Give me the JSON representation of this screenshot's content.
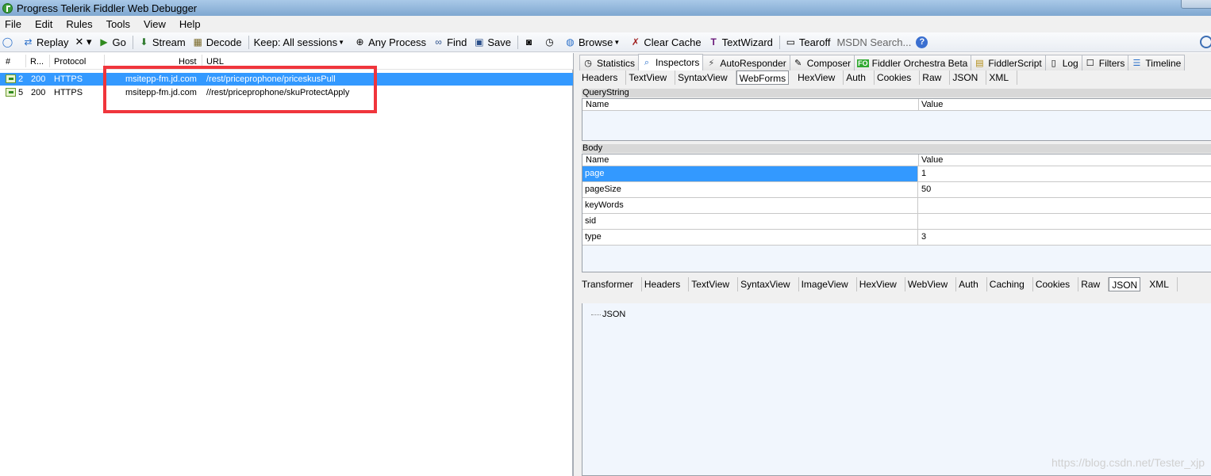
{
  "window": {
    "title": "Progress Telerik Fiddler Web Debugger"
  },
  "menu": [
    "File",
    "Edit",
    "Rules",
    "Tools",
    "View",
    "Help"
  ],
  "toolbar": {
    "replay": "Replay",
    "remove": "✕ ▾",
    "go": "Go",
    "stream": "Stream",
    "decode": "Decode",
    "keep": "Keep: All sessions",
    "process": "Any Process",
    "find": "Find",
    "save": "Save",
    "browse": "Browse",
    "clear_cache": "Clear Cache",
    "textwizard": "TextWizard",
    "tearoff": "Tearoff",
    "search_placeholder": "MSDN Search..."
  },
  "sessions": {
    "columns": {
      "num": "#",
      "result": "R...",
      "protocol": "Protocol",
      "host": "Host",
      "url": "URL"
    },
    "rows": [
      {
        "num": "2",
        "result": "200",
        "protocol": "HTTPS",
        "host": "msitepp-fm.jd.com",
        "url": "/rest/priceprophone/priceskusPull"
      },
      {
        "num": "5",
        "result": "200",
        "protocol": "HTTPS",
        "host": "msitepp-fm.jd.com",
        "url": "//rest/priceprophone/skuProtectApply"
      }
    ]
  },
  "top_tabs": {
    "statistics": "Statistics",
    "inspectors": "Inspectors",
    "autoresponder": "AutoResponder",
    "composer": "Composer",
    "orchestra_badge": "FO",
    "orchestra": "Fiddler Orchestra Beta",
    "fiddlerscript": "FiddlerScript",
    "log": "Log",
    "filters": "Filters",
    "timeline": "Timeline"
  },
  "request_tabs": [
    "Headers",
    "TextView",
    "SyntaxView",
    "WebForms",
    "HexView",
    "Auth",
    "Cookies",
    "Raw",
    "JSON",
    "XML"
  ],
  "querystring": {
    "title": "QueryString",
    "name_col": "Name",
    "value_col": "Value"
  },
  "body": {
    "title": "Body",
    "name_col": "Name",
    "value_col": "Value",
    "rows": [
      {
        "name": "page",
        "value": "1"
      },
      {
        "name": "pageSize",
        "value": "50"
      },
      {
        "name": "keyWords",
        "value": ""
      },
      {
        "name": "sid",
        "value": ""
      },
      {
        "name": "type",
        "value": "3"
      }
    ]
  },
  "response_tabs": [
    "Transformer",
    "Headers",
    "TextView",
    "SyntaxView",
    "ImageView",
    "HexView",
    "WebView",
    "Auth",
    "Caching",
    "Cookies",
    "Raw",
    "JSON",
    "XML"
  ],
  "response_tree": {
    "root": "JSON"
  },
  "watermark": "https://blog.csdn.net/Tester_xjp",
  "colors": {
    "selection": "#3399ff",
    "highlight_box": "#f0353c"
  }
}
